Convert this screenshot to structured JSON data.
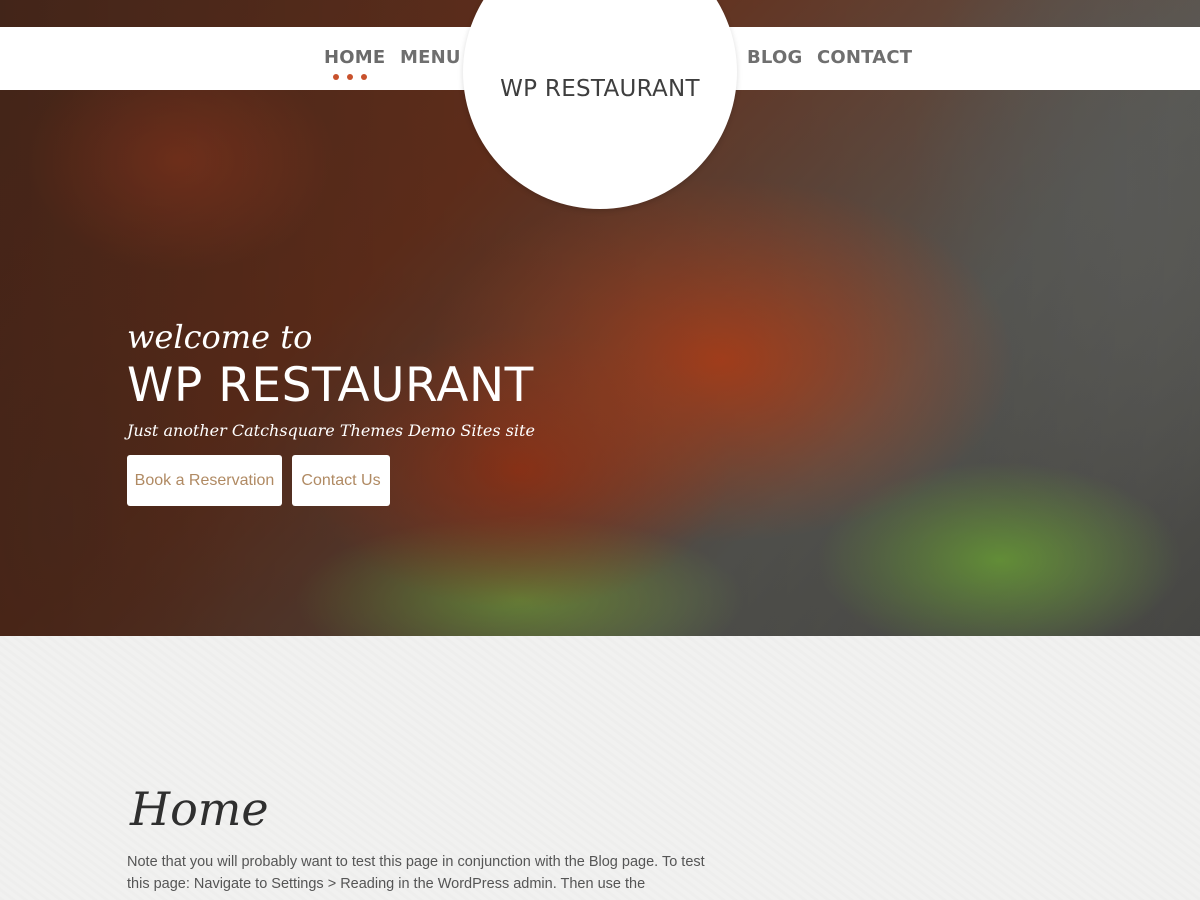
{
  "nav": {
    "items": [
      {
        "label": "HOME",
        "active": true
      },
      {
        "label": "MENU"
      },
      {
        "label": "BLOG"
      },
      {
        "label": "CONTACT"
      }
    ],
    "active_color": "#c8512c"
  },
  "logo": {
    "site_title": "WP RESTAURANT"
  },
  "hero": {
    "welcome": "welcome to",
    "title": "WP RESTAURANT",
    "tagline": "Just another Catchsquare Themes Demo Sites site",
    "buttons": {
      "reservation": "Book a Reservation",
      "contact": "Contact Us"
    },
    "button_text_color": "#b08a63"
  },
  "content": {
    "heading": "Home",
    "body": "Note that you will probably want to test this page in conjunction with the Blog page. To test this page: Navigate to Settings > Reading in the WordPress admin. Then use the"
  }
}
